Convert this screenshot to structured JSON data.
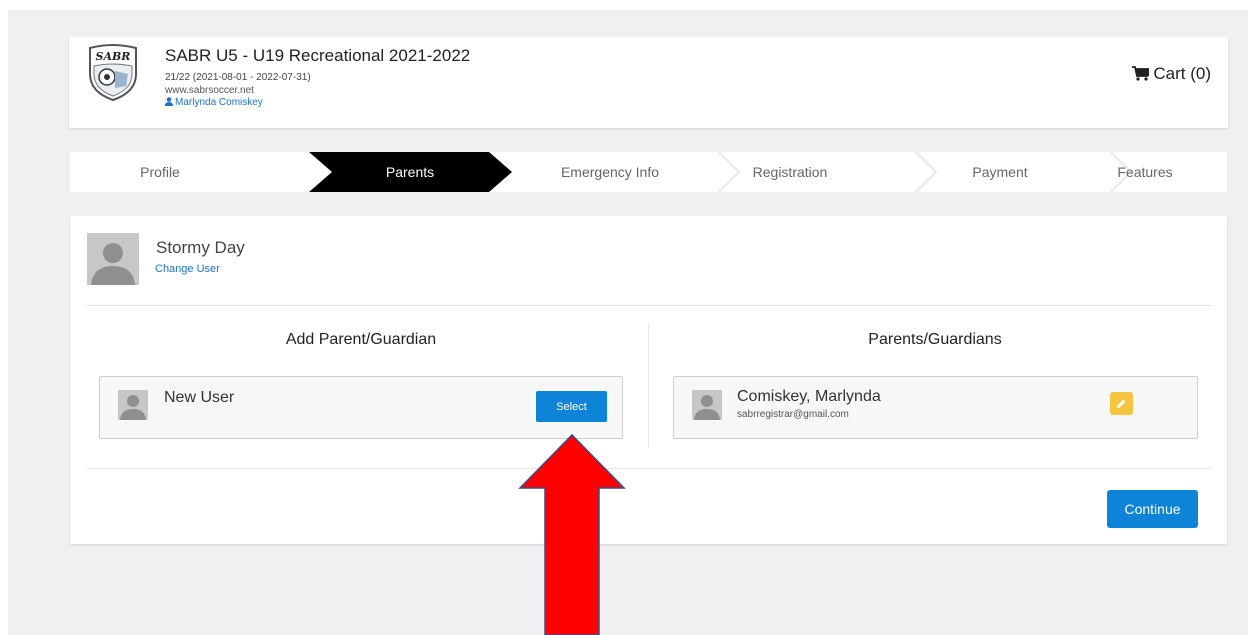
{
  "header": {
    "logo_text": "SABR",
    "title": "SABR U5 - U19 Recreational 2021-2022",
    "season": "21/22 (2021-08-01 - 2022-07-31)",
    "website": "www.sabrsoccer.net",
    "user_name": "Marlynda Comiskey",
    "cart_label": "Cart (0)"
  },
  "steps": {
    "items": [
      "Profile",
      "Parents",
      "Emergency Info",
      "Registration",
      "Payment",
      "Features"
    ],
    "active": "Parents"
  },
  "player": {
    "name": "Stormy Day",
    "change_user_label": "Change User"
  },
  "add_parent": {
    "title": "Add Parent/Guardian",
    "new_user_label": "New User",
    "select_label": "Select"
  },
  "parents": {
    "title": "Parents/Guardians",
    "list": [
      {
        "name": "Comiskey, Marlynda",
        "email": "sabrregistrar@gmail.com"
      }
    ]
  },
  "actions": {
    "continue_label": "Continue"
  },
  "colors": {
    "primary": "#0d84d8",
    "active_step": "#000000",
    "edit": "#f5c542",
    "annotation_arrow": "#ff0000",
    "link": "#1a73c8",
    "page_bg": "#eff0f2"
  }
}
